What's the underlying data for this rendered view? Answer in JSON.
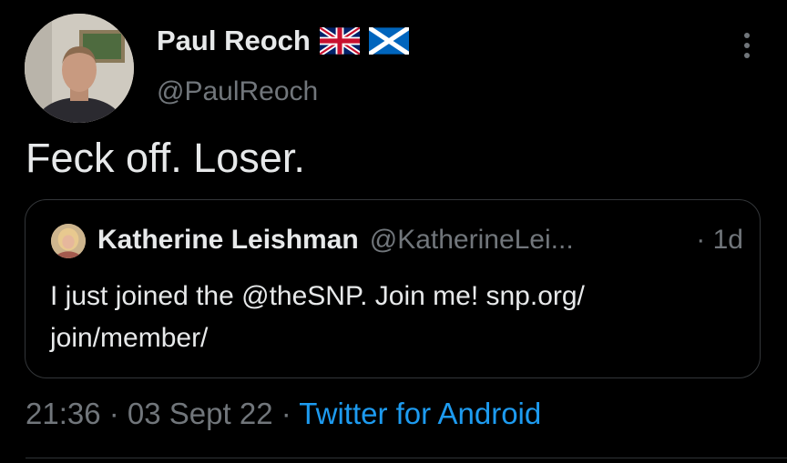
{
  "author": {
    "display_name": "Paul Reoch",
    "handle": "@PaulReoch",
    "flags": [
      "union-jack-flag-icon",
      "scottish-saltire-flag-icon"
    ]
  },
  "tweet": {
    "text": "Feck off. Loser."
  },
  "quoted_tweet": {
    "display_name": "Katherine Leishman",
    "handle": "@KatherineLei...",
    "time": "· 1d",
    "text_line1": "I just joined the @theSNP. Join me! snp.org/",
    "text_line2": "join/member/"
  },
  "meta": {
    "timestamp": "21:36 · 03 Sept 22 · ",
    "source": "Twitter for Android"
  },
  "colors": {
    "background": "#000000",
    "primary_text": "#e7e9ea",
    "secondary_text": "#71767b",
    "link": "#1d9bf0",
    "border": "#333639"
  }
}
